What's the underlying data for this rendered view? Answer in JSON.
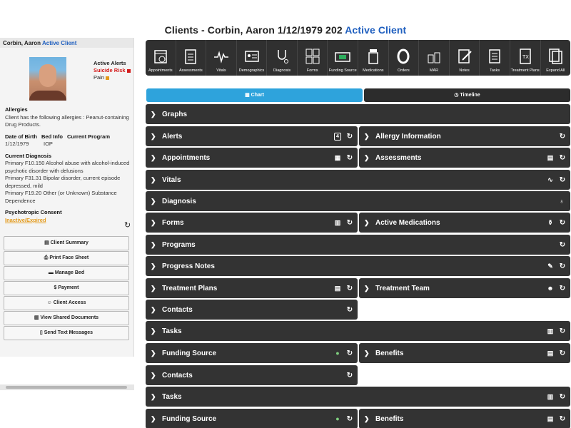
{
  "header": {
    "title_prefix": "Clients - Corbin, Aaron 1/12/1979 202",
    "title_status": "Active Client"
  },
  "sidebar": {
    "client_name": "Corbin, Aaron",
    "client_status": "Active Client",
    "alerts_title": "Active Alerts",
    "alert_1": "Suicide Risk",
    "alert_2": "Pain",
    "allergies_label": "Allergies",
    "allergies_text": "Client has the following allergies : Peanut-containing Drug Products.",
    "dob_label": "Date of Birth",
    "dob_value": "1/12/1979",
    "bed_label": "Bed Info",
    "program_label": "Current Program",
    "program_value": "IOP",
    "diagnosis_label": "Current Diagnosis",
    "diagnosis_1": "Primary F10.150 Alcohol abuse with alcohol-induced psychotic disorder with delusions",
    "diagnosis_2": "Primary F31.31 Bipolar disorder, current episode depressed, mild",
    "diagnosis_3": "Primary F19.20 Other (or Unknown) Substance Dependence",
    "consent_label": "Psychotropic Consent",
    "consent_value": "Inactive/Expired",
    "buttons": [
      {
        "label": "Client Summary",
        "icon": "list-icon"
      },
      {
        "label": "Print Face Sheet",
        "icon": "print-icon"
      },
      {
        "label": "Manage Bed",
        "icon": "bed-icon"
      },
      {
        "label": "Payment",
        "icon": "dollar-icon"
      },
      {
        "label": "Client Access",
        "icon": "users-icon"
      },
      {
        "label": "View Shared Documents",
        "icon": "document-icon"
      },
      {
        "label": "Send Text Messages",
        "icon": "phone-icon"
      }
    ]
  },
  "toolbar": {
    "items": [
      {
        "label": "Appointments",
        "icon": "calendar-check-icon"
      },
      {
        "label": "Assessments",
        "icon": "clipboard-icon"
      },
      {
        "label": "Vitals",
        "icon": "heartbeat-icon"
      },
      {
        "label": "Demographics",
        "icon": "id-card-icon"
      },
      {
        "label": "Diagnosis",
        "icon": "stethoscope-icon"
      },
      {
        "label": "Forms",
        "icon": "forms-icon"
      },
      {
        "label": "Funding Source",
        "icon": "money-icon"
      },
      {
        "label": "Medications",
        "icon": "pill-bottle-icon"
      },
      {
        "label": "Orders",
        "icon": "orders-icon"
      },
      {
        "label": "MAR",
        "icon": "mar-icon"
      },
      {
        "label": "Notes",
        "icon": "notes-icon"
      },
      {
        "label": "Tasks",
        "icon": "tasks-icon"
      },
      {
        "label": "Treatment Plans",
        "icon": "treatment-plan-icon"
      },
      {
        "label": "Expand All",
        "icon": "expand-icon"
      }
    ]
  },
  "tabs": {
    "chart": "Chart",
    "timeline": "Timeline"
  },
  "sections": {
    "graphs": "Graphs",
    "alerts": "Alerts",
    "alerts_count": "4",
    "allergy_information": "Allergy Information",
    "appointments": "Appointments",
    "assessments": "Assessments",
    "vitals": "Vitals",
    "diagnosis": "Diagnosis",
    "forms": "Forms",
    "active_medications": "Active Medications",
    "programs": "Programs",
    "progress_notes": "Progress Notes",
    "treatment_plans": "Treatment Plans",
    "treatment_team": "Treatment Team",
    "contacts": "Contacts",
    "tasks": "Tasks",
    "funding_source": "Funding Source",
    "benefits": "Benefits"
  },
  "colors": {
    "accent_blue": "#2ea3dc",
    "bar_dark": "#333333",
    "alert_red": "#d31b1b",
    "consent_orange": "#e39a1b"
  }
}
